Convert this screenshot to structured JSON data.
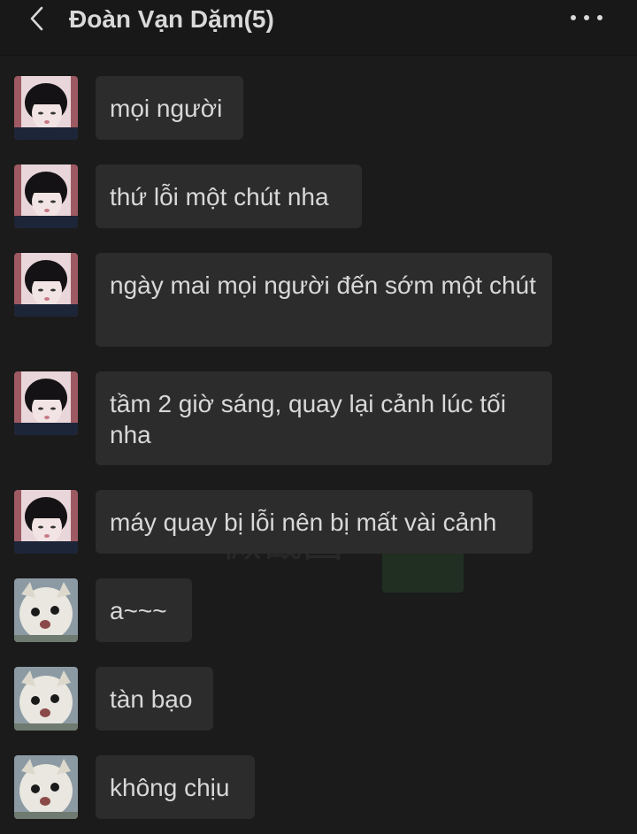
{
  "header": {
    "title": "Đoàn Vạn Dặm(5)",
    "back_icon": "chevron-left-icon",
    "more_icon": "more-dots-icon"
  },
  "messages": [
    {
      "sender": "girl",
      "text": "mọi người"
    },
    {
      "sender": "girl",
      "text": "thứ lỗi một chút nha"
    },
    {
      "sender": "girl",
      "text": "ngày mai mọi người đến sớm một chút"
    },
    {
      "sender": "girl",
      "text": "tầm 2 giờ sáng, quay lại cảnh lúc tối nha"
    },
    {
      "sender": "girl",
      "text": "máy quay bị lỗi nên bị mất vài cảnh"
    },
    {
      "sender": "cat",
      "text": "a~~~"
    },
    {
      "sender": "cat",
      "text": "tàn bạo"
    },
    {
      "sender": "cat",
      "text": "không chịu"
    }
  ],
  "watermark": {
    "text": "微截图"
  },
  "colors": {
    "background": "#1b1b1b",
    "header": "#181818",
    "bubble": "#2c2c2c",
    "text": "#d8d8d8"
  }
}
